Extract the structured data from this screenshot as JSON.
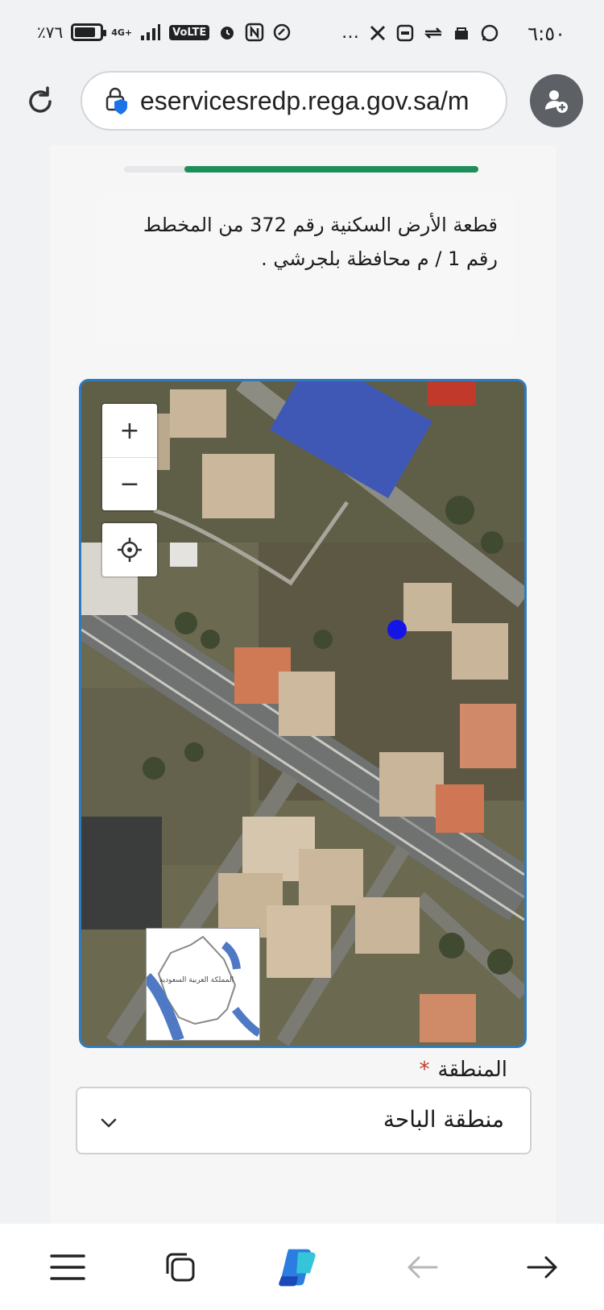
{
  "status_bar": {
    "time": "٦:٥٠",
    "battery": "٪٧٦",
    "network": "4G+",
    "volte": "VoLTE",
    "overflow": "…",
    "notification_icons": [
      "whatsapp-icon",
      "app-icon",
      "app-icon",
      "app-icon",
      "x-icon"
    ]
  },
  "browser": {
    "url": "eservicesredp.rega.gov.sa/m",
    "reload_icon": "reload-icon",
    "site_security_icon": "lock-shield-icon",
    "profile_icon": "add-profile-icon"
  },
  "form": {
    "progress_fraction": 0.83,
    "property_description": "قطعة الأرض السكنية رقم 372 من المخطط رقم 1 / م محافظة بلجرشي .",
    "map": {
      "zoom_in_label": "+",
      "zoom_out_label": "−",
      "locate_icon": "crosshair-icon",
      "overview_label": "المملكة العربية السعودية"
    },
    "region": {
      "label": "المنطقة",
      "required_mark": "*",
      "value": "منطقة الباحة"
    }
  },
  "bottom_nav": {
    "items": [
      "menu-icon",
      "tabs-icon",
      "copilot-icon",
      "back-arrow-icon",
      "forward-arrow-icon"
    ]
  },
  "colors": {
    "accent_progress": "#1e8e5a",
    "map_border": "#2f7bbf",
    "marker": "#1414e6",
    "required": "#c0392b"
  }
}
